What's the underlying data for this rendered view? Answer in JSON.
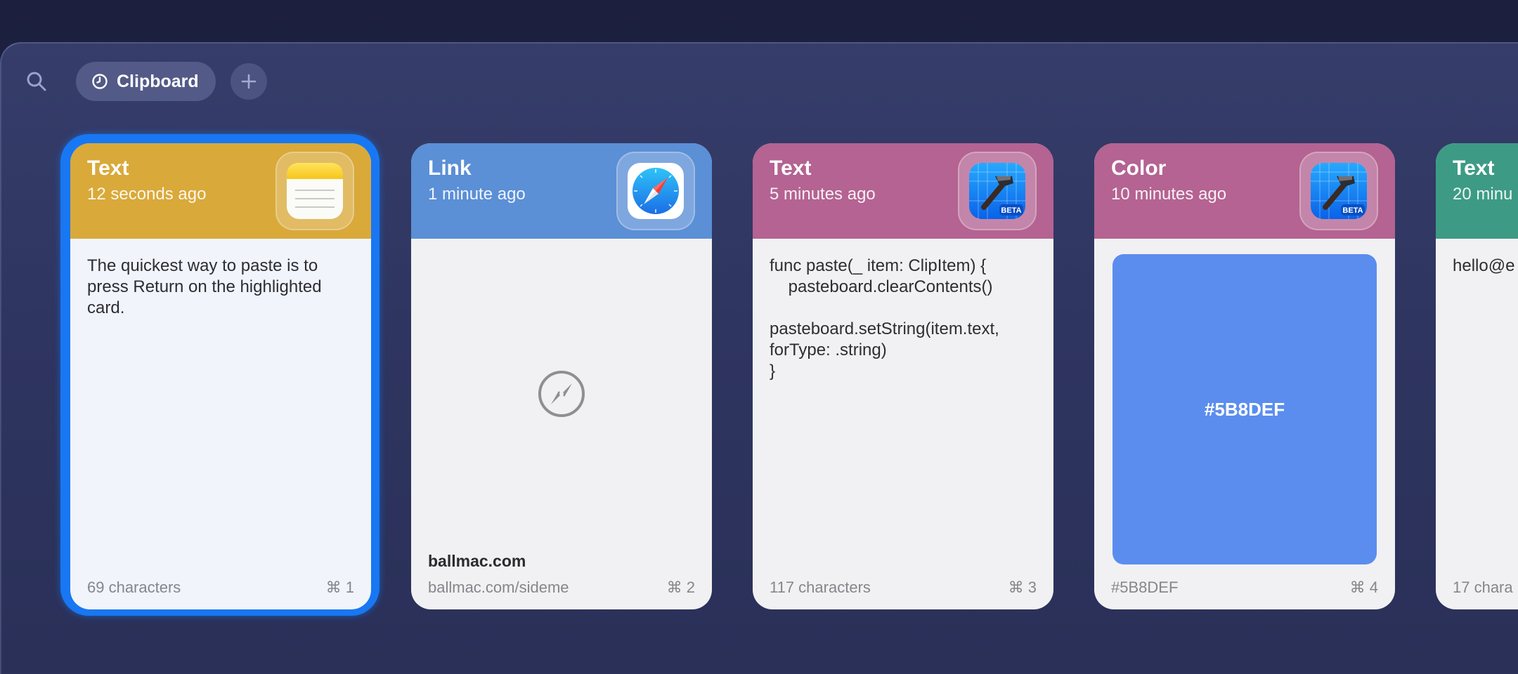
{
  "toolbar": {
    "search_icon": "search-icon",
    "active_tab": "Clipboard",
    "active_tab_icon": "clock-icon",
    "add_icon": "plus-icon"
  },
  "cards": [
    {
      "type": "Text",
      "time": "12 seconds ago",
      "app_icon": "notes-app-icon",
      "content": "The quickest way to paste is to press Return on the highlighted card.",
      "meta": "69 characters",
      "shortcut": "⌘ 1",
      "header_color": "#d9a93a"
    },
    {
      "type": "Link",
      "time": "1 minute ago",
      "app_icon": "safari-app-icon",
      "link_title": "ballmac.com",
      "meta": "ballmac.com/sideme",
      "shortcut": "⌘ 2",
      "header_color": "#5b8fd6"
    },
    {
      "type": "Text",
      "time": "5 minutes ago",
      "app_icon": "xcode-beta-app-icon",
      "content": "func paste(_ item: ClipItem) {\n    pasteboard.clearContents()\n\npasteboard.setString(item.text,\nforType: .string)\n}",
      "meta": "117 characters",
      "shortcut": "⌘ 3",
      "header_color": "#b46392"
    },
    {
      "type": "Color",
      "time": "10 minutes ago",
      "app_icon": "xcode-beta-app-icon",
      "swatch_label": "#5B8DEF",
      "meta": "#5B8DEF",
      "shortcut": "⌘ 4",
      "header_color": "#b46392",
      "swatch_color": "#5b8def"
    },
    {
      "type": "Text",
      "time": "20 minu",
      "content": "hello@e",
      "meta": "17 chara",
      "header_color": "#3d9b85"
    }
  ],
  "beta_badge": "BETA"
}
